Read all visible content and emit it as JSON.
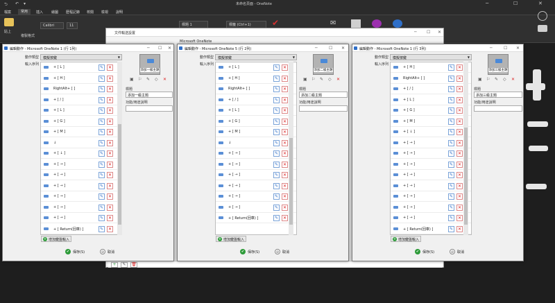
{
  "app": {
    "title": "未命名頁面 - OneNote",
    "menu": [
      "檔案",
      "常用",
      "插入",
      "繪圖",
      "歷程記錄",
      "校閱",
      "檢視",
      "說明"
    ],
    "active_menu": "常用",
    "ribbon": {
      "paste": "貼上",
      "format_painter": "複製格式",
      "font": "Calibri",
      "size": "11",
      "style": "標題 1",
      "tag": "標籤 (Ctrl+1)",
      "tag_color": "#d32f2f",
      "accent": "#9b2fae"
    }
  },
  "bg_dialog": {
    "title": "文件輸送設置",
    "sub_title": "Microsoft OneNote"
  },
  "dialog_common": {
    "action_type_label": "動作類型",
    "action_type_value": "模擬按鍵",
    "input_seq_label": "輸入序列",
    "add_button": "增加鍵盤輸入",
    "title_label": "標題",
    "desc_label": "功能/用途說明",
    "save": "保存(S)",
    "cancel": "取消"
  },
  "dialogs": [
    {
      "title": "編輯動作 - Microsoft OneNote 1 (行 1列)",
      "preview_text": "添加一級主題",
      "title_value": "添加一級主題",
      "rows": [
        "+ [ L ]",
        "+ [ H ]",
        "RightAlt+ [ ]",
        "+ [ / ]",
        "+ [ L ]",
        "+ [ G ]",
        "+ [ M ]",
        "↓",
        "+ [ ↓ ]",
        "+ [ → ]",
        "+ [ → ]",
        "+ [ → ]",
        "+ [ → ]",
        "+ [ → ]",
        "+ [ → ]",
        "+ [ Return(回車) ]"
      ]
    },
    {
      "title": "編輯動作 - Microsoft OneNote 5 (行 2列)",
      "preview_text": "添加二級主題",
      "title_value": "添加二級主題",
      "rows": [
        "+ [ L ]",
        "+ [ H ]",
        "RightAlt+ [ ]",
        "+ [ / ]",
        "+ [ L ]",
        "+ [ G ]",
        "+ [ M ]",
        "↓",
        "+ [ → ]",
        "+ [ → ]",
        "+ [ → ]",
        "+ [ → ]",
        "+ [ → ]",
        "+ [ → ]",
        "+ [ Return(回車) ]"
      ]
    },
    {
      "title": "編輯動作 - Microsoft OneNote 1 (行 3列)",
      "preview_text": "添加三級主題",
      "title_value": "添加三級主題",
      "rows": [
        "+ [ H ]",
        "RightAlt+ [ ]",
        "+ [ / ]",
        "+ [ L ]",
        "+ [ G ]",
        "+ [ M ]",
        "+ [ ↓ ]",
        "+ [ → ]",
        "+ [ → ]",
        "+ [ → ]",
        "+ [ → ]",
        "+ [ → ]",
        "+ [ → ]",
        "+ [ → ]",
        "+ [ → ]",
        "+ [ Return(回車) ]"
      ]
    }
  ]
}
